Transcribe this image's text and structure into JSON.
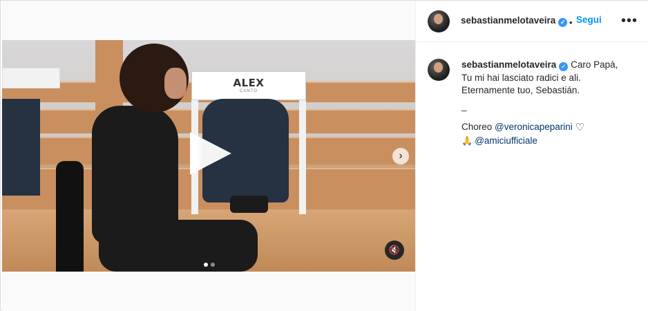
{
  "post": {
    "username": "sebastianmelotaveira",
    "follow_label": "Segui",
    "separator": "•",
    "more_label": "•••",
    "verified_glyph": "✓"
  },
  "media": {
    "sign_name": "ALEX",
    "sign_sub": "CANTO",
    "next_glyph": "›",
    "mute_glyph": "🔇",
    "carousel_index": 1,
    "carousel_total": 2
  },
  "caption": {
    "line1": "Caro Papà,",
    "line2": "Tu mi hai lasciato radici e ali.",
    "line3": "Eternamente tuo, Sebastián.",
    "line4": "_",
    "choreo_prefix": "Choreo ",
    "mention1": "@veronicapeparini",
    "heart": "♡",
    "hands": "🙏",
    "mention2": "@amiciufficiale"
  },
  "icons": {
    "verified": "verified-badge-icon",
    "more": "more-options-icon",
    "play": "play-icon",
    "next": "chevron-right-icon",
    "mute": "speaker-muted-icon"
  },
  "colors": {
    "link": "#0095f6",
    "mention": "#00376b",
    "verified": "#3897f0",
    "text": "#262626"
  }
}
